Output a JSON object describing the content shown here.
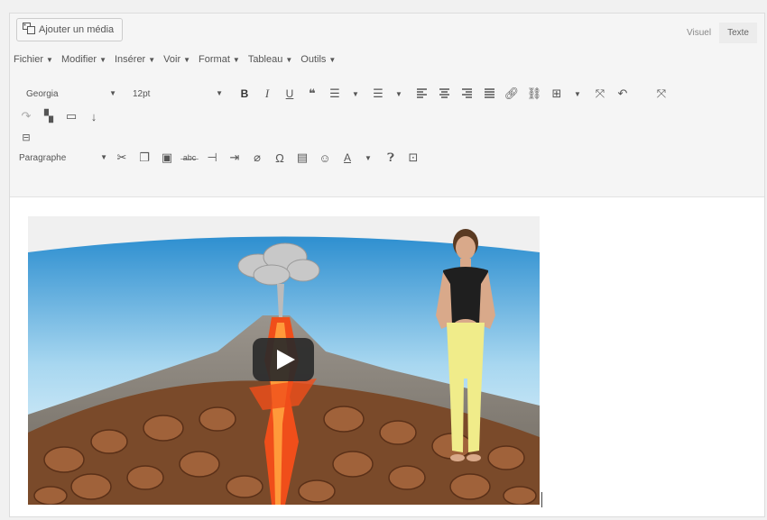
{
  "topbar": {
    "add_media_label": "Ajouter un média",
    "tabs": [
      {
        "label": "Visuel",
        "active": true
      },
      {
        "label": "Texte",
        "active": false
      }
    ]
  },
  "menubar": {
    "items": [
      "Fichier",
      "Modifier",
      "Insérer",
      "Voir",
      "Format",
      "Tableau",
      "Outils"
    ]
  },
  "toolbar": {
    "font_family": "Georgia",
    "font_size": "12pt",
    "paragraph_format": "Paragraphe",
    "bold_glyph": "B",
    "italic_glyph": "I",
    "underline_glyph": "U",
    "omega_glyph": "Ω",
    "text_color_glyph": "A"
  },
  "colors": {
    "sky": "#7fc3e8",
    "lava": "#f04e1a",
    "play_button": "#2a2a2a",
    "editor_bg": "#f5f5f5"
  },
  "content": {
    "video": {
      "has_play_button": true
    }
  }
}
